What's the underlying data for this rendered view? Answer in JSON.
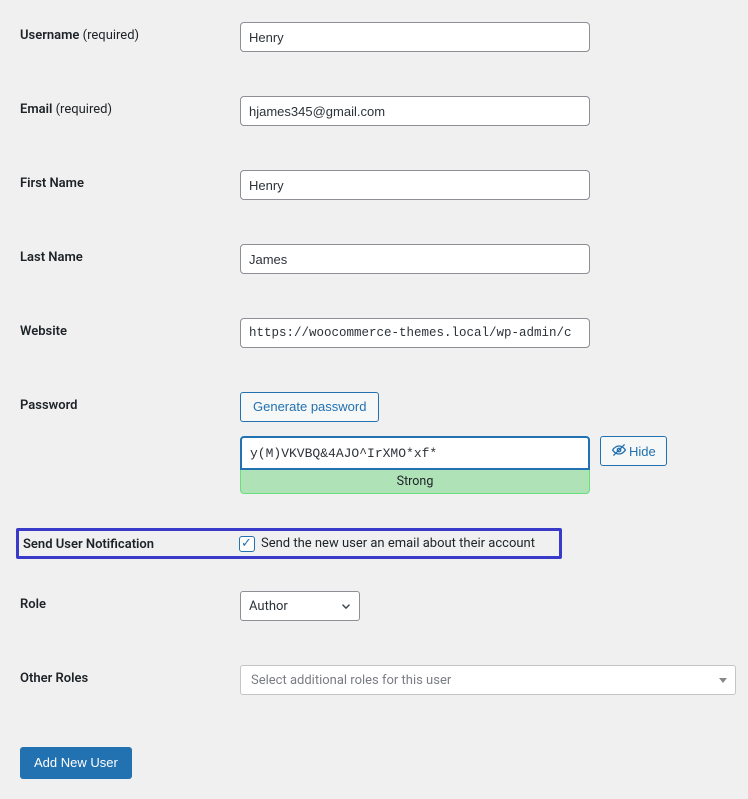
{
  "fields": {
    "username": {
      "label": "Username",
      "req": "(required)",
      "value": "Henry"
    },
    "email": {
      "label": "Email",
      "req": "(required)",
      "value": "hjames345@gmail.com"
    },
    "first": {
      "label": "First Name",
      "value": "Henry"
    },
    "last": {
      "label": "Last Name",
      "value": "James"
    },
    "website": {
      "label": "Website",
      "value": "https://woocommerce-themes.local/wp-admin/c"
    }
  },
  "password": {
    "label": "Password",
    "generate": "Generate password",
    "value": "y(M)VKVBQ&4AJO^IrXMO*xf*",
    "hide": "Hide",
    "strength": "Strong"
  },
  "notification": {
    "label": "Send User Notification",
    "checked": true,
    "text": "Send the new user an email about their account"
  },
  "role": {
    "label": "Role",
    "value": "Author"
  },
  "other_roles": {
    "label": "Other Roles",
    "placeholder": "Select additional roles for this user"
  },
  "submit": "Add New User"
}
